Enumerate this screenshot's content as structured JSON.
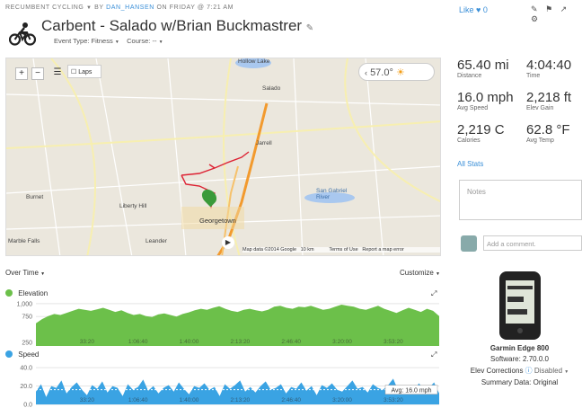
{
  "header": {
    "activity_type": "RECUMBENT CYCLING",
    "by": "BY",
    "author": "DAN_HANSEN",
    "when": "ON FRIDAY @ 7:21 AM",
    "title": "Carbent - Salado w/Brian Buckmastrer",
    "event_type": "Event Type: Fitness",
    "course": "Course: --",
    "like_label": "Like",
    "like_count": "0"
  },
  "map": {
    "temperature": "57.0°",
    "laps_label": "Laps",
    "copyright": "Map data ©2014 Google",
    "scale": "10 km",
    "terms": "Terms of Use",
    "report": "Report a map error",
    "places": [
      {
        "name": "Hollow Lake"
      },
      {
        "name": "Salado"
      },
      {
        "name": "Jarrell"
      },
      {
        "name": "Burnet"
      },
      {
        "name": "Liberty Hill"
      },
      {
        "name": "Georgetown"
      },
      {
        "name": "San Gabriel River"
      },
      {
        "name": "Leander"
      },
      {
        "name": "Marble Falls"
      }
    ]
  },
  "stats": [
    {
      "value": "65.40 mi",
      "label": "Distance"
    },
    {
      "value": "4:04:40",
      "label": "Time"
    },
    {
      "value": "16.0 mph",
      "label": "Avg Speed"
    },
    {
      "value": "2,218 ft",
      "label": "Elev Gain"
    },
    {
      "value": "2,219 C",
      "label": "Calories"
    },
    {
      "value": "62.8 °F",
      "label": "Avg Temp"
    }
  ],
  "all_stats": "All Stats",
  "notes_placeholder": "Notes",
  "comment_placeholder": "Add a comment.",
  "chart_controls": {
    "over_time": "Over Time",
    "customize": "Customize"
  },
  "elevation_label": "Elevation",
  "speed_label": "Speed",
  "avg_label": "Avg: 16.0 mph",
  "device": {
    "name": "Garmin Edge 800",
    "software": "Software: 2.70.0.0",
    "elev": "Elev Corrections",
    "elev_value": "Disabled",
    "summary": "Summary Data: Original"
  },
  "chart_data": [
    {
      "type": "area",
      "title": "Elevation",
      "x_ticks": [
        "33:20",
        "1:06:40",
        "1:40:00",
        "2:13:20",
        "2:46:40",
        "3:20:00",
        "3:53:20"
      ],
      "y_ticks": [
        250,
        750,
        1000
      ],
      "ylim": [
        180,
        1050
      ],
      "values": [
        620,
        700,
        760,
        800,
        780,
        820,
        860,
        900,
        880,
        860,
        890,
        920,
        880,
        840,
        870,
        820,
        780,
        800,
        760,
        740,
        790,
        810,
        780,
        750,
        800,
        830,
        870,
        900,
        880,
        920,
        950,
        900,
        860,
        840,
        880,
        900,
        870,
        850,
        880,
        940,
        960,
        920,
        900,
        940,
        930,
        960,
        920,
        880,
        900,
        940,
        980,
        960,
        940,
        900,
        880,
        920,
        960,
        900,
        860,
        820,
        870,
        920,
        880,
        840,
        900,
        860,
        760
      ]
    },
    {
      "type": "area",
      "title": "Speed",
      "x_ticks": [
        "33:20",
        "1:06:40",
        "1:40:00",
        "2:13:20",
        "2:46:40",
        "3:20:00",
        "3:53:20"
      ],
      "y_ticks": [
        0.0,
        20.0,
        40.0
      ],
      "ylim": [
        0,
        45
      ],
      "average": 16.0,
      "values": [
        14,
        22,
        8,
        20,
        18,
        26,
        12,
        19,
        24,
        16,
        10,
        21,
        17,
        25,
        13,
        20,
        18,
        9,
        22,
        16,
        19,
        27,
        15,
        20,
        12,
        18,
        21,
        14,
        24,
        17,
        11,
        20,
        18,
        23,
        16,
        19,
        9,
        22,
        17,
        21,
        26,
        14,
        19,
        13,
        20,
        25,
        16,
        18,
        22,
        12,
        19,
        17,
        24,
        15,
        20,
        10,
        21,
        18,
        23,
        16,
        14,
        20,
        26,
        17,
        19,
        13,
        22,
        18,
        16,
        21,
        28,
        15,
        19,
        20,
        14,
        23,
        17,
        18,
        24,
        12
      ]
    }
  ]
}
